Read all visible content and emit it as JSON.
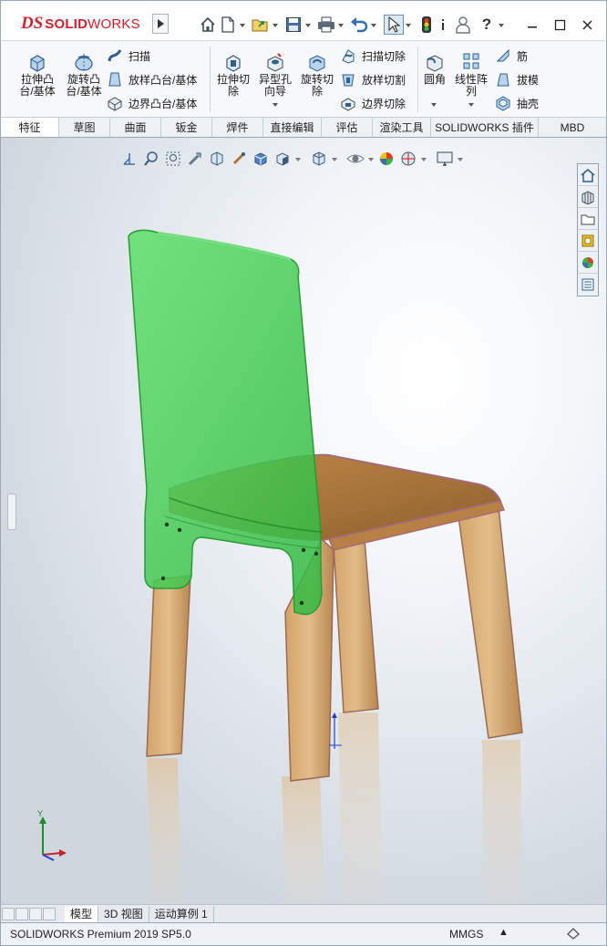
{
  "app": {
    "logo_ds": "DS",
    "logo_solid": "SOLID",
    "logo_works": "WORKS",
    "accent_color": "#d5202c",
    "help_glyph": "?"
  },
  "quick_access": [
    "home-icon",
    "new-document-icon",
    "open-icon",
    "save-icon",
    "print-icon",
    "undo-icon",
    "select-arrow-icon",
    "rebuild-icon",
    "options-icon",
    "user-icon",
    "help-icon"
  ],
  "ribbon": {
    "extrude_boss": "拉伸凸台/基体",
    "revolve_boss": "旋转凸台/基体",
    "sweep": "扫描",
    "loft_boss": "放样凸台/基体",
    "boundary_boss": "边界凸台/基体",
    "extrude_cut": "拉伸切除",
    "hole_wizard": "异型孔向导",
    "revolve_cut": "旋转切除",
    "swept_cut": "扫描切除",
    "lofted_cut": "放样切割",
    "boundary_cut": "边界切除",
    "fillet": "圆角",
    "linear_pattern": "线性阵列",
    "rib": "筋",
    "draft": "拔模",
    "shell": "抽壳"
  },
  "tabs": [
    "特征",
    "草图",
    "曲面",
    "钣金",
    "焊件",
    "直接编辑",
    "评估",
    "渲染工具",
    "SOLIDWORKS 插件",
    "MBD"
  ],
  "active_tab": 0,
  "bottom_tabs": [
    "模型",
    "3D 视图",
    "运动算例 1"
  ],
  "active_bottom_tab": 0,
  "status": {
    "product": "SOLIDWORKS Premium 2019 SP5.0",
    "units": "MMGS",
    "units_arrow": "▲"
  },
  "model": {
    "seat_color": "#a8763e",
    "back_highlight_color": "#4fd45a",
    "leg_color": "#c99a5c",
    "edge_color": "#a56a78"
  }
}
